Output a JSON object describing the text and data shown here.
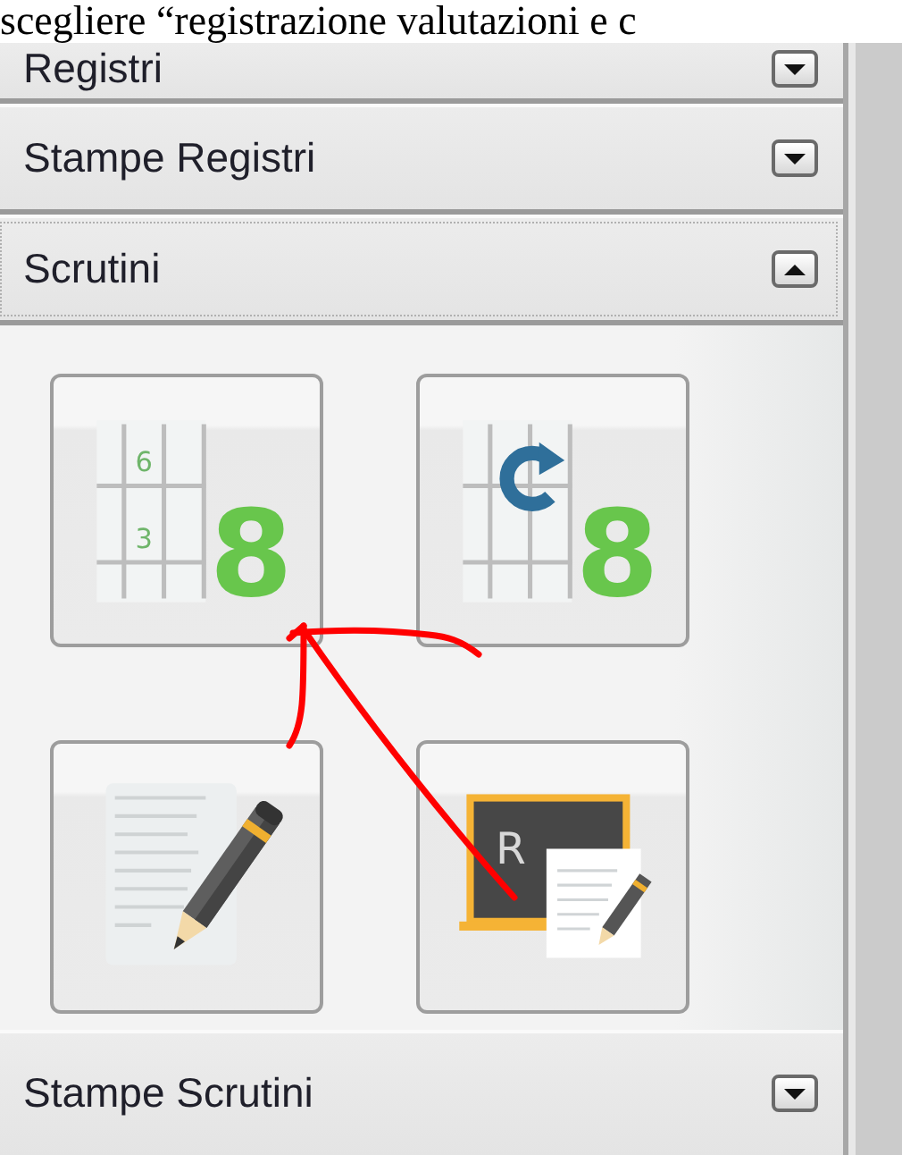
{
  "caption": "scegliere “registrazione valutazioni e c",
  "sections": [
    {
      "title": "Registri",
      "expanded": false,
      "focused": false
    },
    {
      "title": "Stampe Registri",
      "expanded": false,
      "focused": false
    },
    {
      "title": "Scrutini",
      "expanded": true,
      "focused": true,
      "tiles": [
        {
          "kind": "grades",
          "big_digit": "8",
          "small_digits": [
            "6",
            "3"
          ]
        },
        {
          "kind": "grades-refresh",
          "big_digit": "8"
        },
        {
          "kind": "notes"
        },
        {
          "kind": "blackboard",
          "chalk_text": "R"
        }
      ]
    },
    {
      "title": "Stampe Scrutini",
      "expanded": false,
      "focused": false
    }
  ]
}
